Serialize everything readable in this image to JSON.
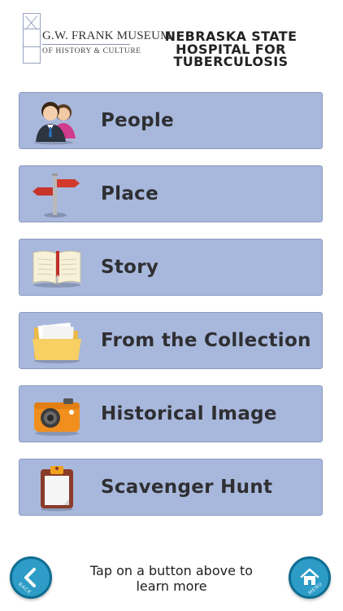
{
  "header": {
    "logo_name": "G.W. FRANK MUSEUM",
    "logo_sub": "OF HISTORY & CULTURE",
    "title": "NEBRASKA STATE HOSPITAL FOR TUBERCULOSIS"
  },
  "menu": {
    "items": [
      {
        "label": "People",
        "icon": "people-icon"
      },
      {
        "label": "Place",
        "icon": "signpost-icon"
      },
      {
        "label": "Story",
        "icon": "open-book-icon"
      },
      {
        "label": "From the Collection",
        "icon": "folder-icon"
      },
      {
        "label": "Historical Image",
        "icon": "camera-icon"
      },
      {
        "label": "Scavenger Hunt",
        "icon": "clipboard-icon"
      }
    ]
  },
  "footer": {
    "back_caption": "BACK",
    "hint": "Tap on a button above to learn more",
    "menu_caption": "MENU"
  },
  "colors": {
    "button_fill": "#a8b8dc",
    "round_button": "#2d9cc7"
  }
}
